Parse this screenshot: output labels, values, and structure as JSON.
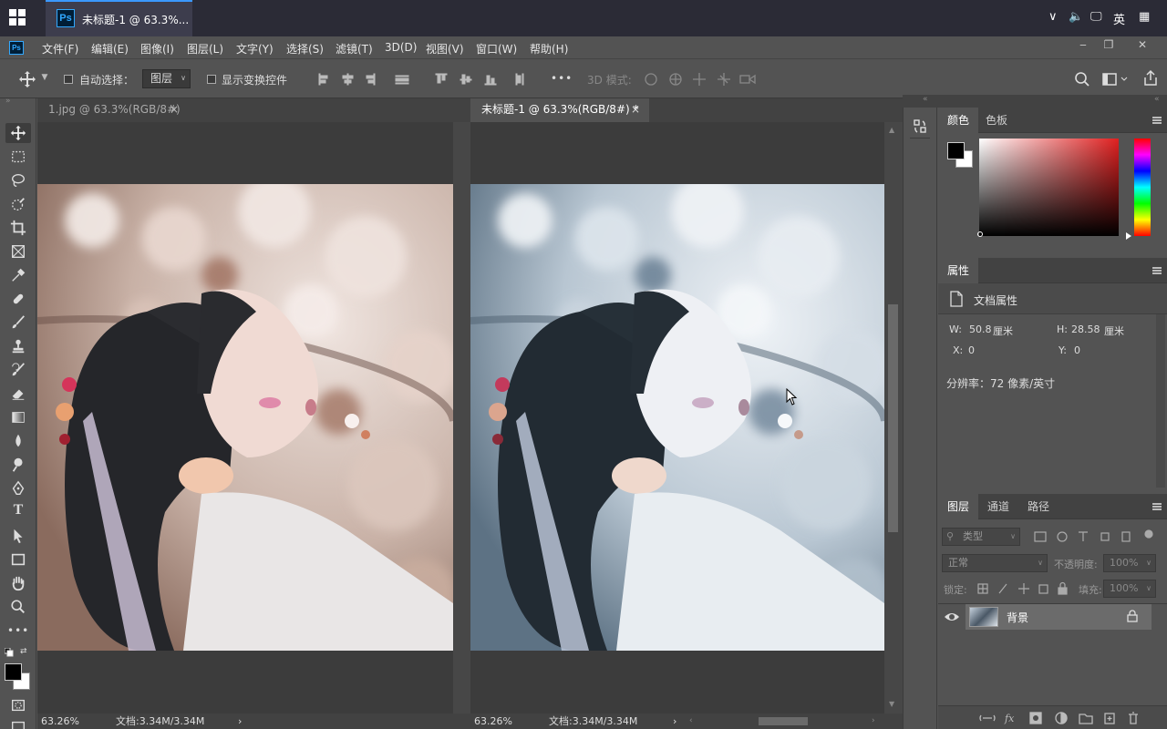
{
  "taskbar": {
    "app_title": "未标题-1 @ 63.3%...",
    "ps_short": "Ps",
    "lang": "英",
    "chevron": "∨",
    "volume": "🔈",
    "network": "🖵",
    "keyboard": "▦"
  },
  "menu": {
    "logo": "Ps",
    "items": [
      "文件(F)",
      "编辑(E)",
      "图像(I)",
      "图层(L)",
      "文字(Y)",
      "选择(S)",
      "滤镜(T)",
      "3D(D)",
      "视图(V)",
      "窗口(W)",
      "帮助(H)"
    ],
    "window_controls": [
      "‒",
      "❐",
      "✕"
    ]
  },
  "options": {
    "auto_select_label": "自动选择：",
    "auto_select_value": "图层",
    "show_transform_label": "显示变换控件",
    "mode_3d_label": "3D 模式:",
    "more": "•••"
  },
  "documents": [
    {
      "tab_title": "1.jpg @ 63.3%(RGB/8#)",
      "close": "×",
      "zoom": "63.26%",
      "doc_info": "文档:3.34M/3.34M",
      "arrow": "›",
      "active": false
    },
    {
      "tab_title": "未标题-1 @ 63.3%(RGB/8#) *",
      "close": "×",
      "zoom": "63.26%",
      "doc_info": "文档:3.34M/3.34M",
      "arrow": "›",
      "active": true
    }
  ],
  "color_panel": {
    "tabs": [
      "颜色",
      "色板"
    ],
    "foreground": "#000000",
    "background": "#ffffff",
    "hue_color": "#e02020"
  },
  "properties_panel": {
    "tab": "属性",
    "title": "文档属性",
    "w_label": "W:",
    "w_value": "50.8",
    "w_unit": "厘米",
    "h_label": "H:",
    "h_value": "28.58",
    "h_unit": "厘米",
    "x_label": "X:",
    "x_value": "0",
    "y_label": "Y:",
    "y_value": "0",
    "resolution": "分辨率：72 像素/英寸"
  },
  "layers_panel": {
    "tabs": [
      "图层",
      "通道",
      "路径"
    ],
    "filter_placeholder": "类型",
    "blend_mode": "正常",
    "opacity_label": "不透明度:",
    "opacity_value": "100%",
    "lock_label": "锁定:",
    "fill_label": "填充:",
    "fill_value": "100%",
    "layers": [
      {
        "name": "背景",
        "visible": true,
        "locked": true
      }
    ]
  },
  "colors": {
    "ps_blue": "#31a8ff",
    "panel_bg": "#535353",
    "tab_bg": "#424242"
  }
}
